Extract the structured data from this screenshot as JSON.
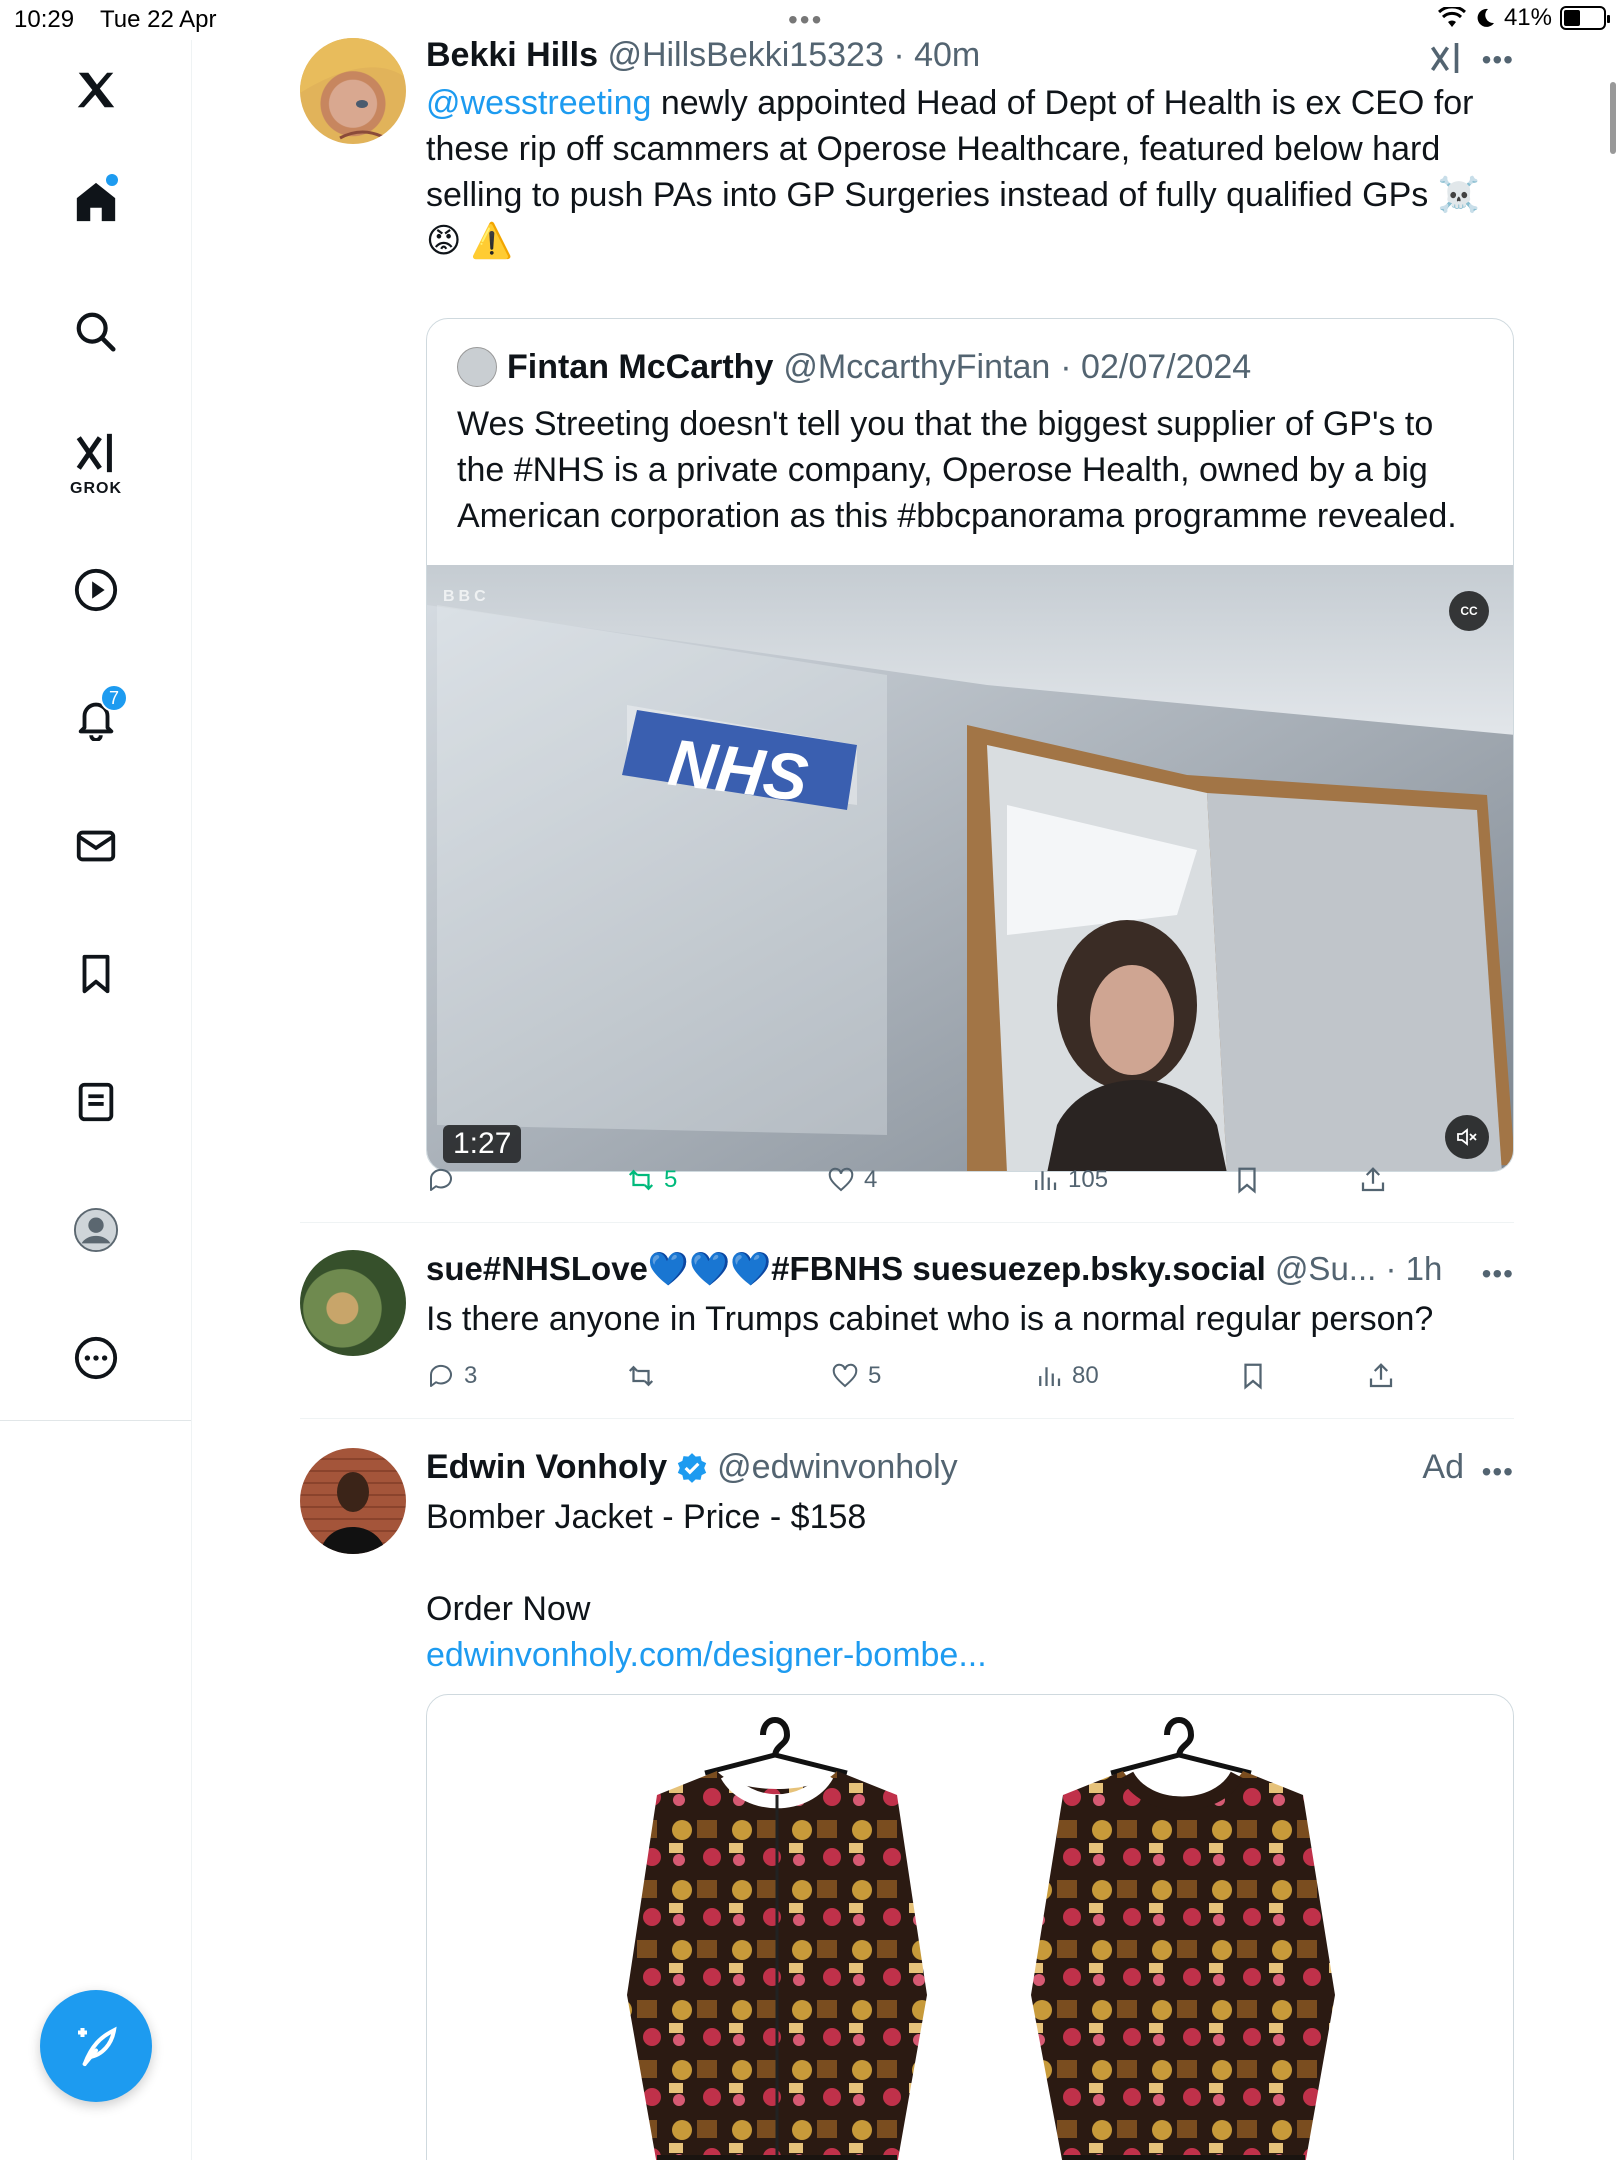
{
  "status_bar": {
    "time": "10:29",
    "date": "Tue 22 Apr",
    "battery": "41%"
  },
  "sidebar": {
    "notifications_count": "7",
    "grok_label": "GROK"
  },
  "tweets": [
    {
      "name": "Bekki Hills",
      "handle": "@HillsBekki15323",
      "time": "· 40m",
      "mention": "@wesstreeting",
      "text": " newly appointed  Head of Dept of Health is ex CEO for these rip off scammers at Operose Healthcare, featured below hard selling to push PAs into GP Surgeries instead of fully qualified GPs ☠️",
      "emoji_line": "😡 ⚠️",
      "quote": {
        "name": "Fintan McCarthy",
        "handle": "@MccarthyFintan",
        "date": "· 02/07/2024",
        "text": "Wes Streeting doesn't tell you that the biggest supplier of GP's to the #NHS is a private company, Operose Health, owned by a big American corporation as this #bbcpanorama programme revealed.",
        "video_duration": "1:27",
        "video_sign": "NHS",
        "video_watermark": "BBC",
        "cc_label": "CC"
      },
      "stats": {
        "replies": "",
        "retweets": "5",
        "likes": "4",
        "views": "105"
      }
    },
    {
      "name": "sue#NHSLove💙💙💙#FBNHS suesuezep.bsky.social",
      "handle": "@Su...",
      "time": "· 1h",
      "text": "Is there anyone in Trumps cabinet who is a normal regular person?",
      "stats": {
        "replies": "3",
        "retweets": "",
        "likes": "5",
        "views": "80"
      }
    },
    {
      "name": "Edwin Vonholy",
      "handle": "@edwinvonholy",
      "ad_label": "Ad",
      "line1": "Bomber Jacket - Price - $158",
      "line2": "Order Now",
      "link": "edwinvonholy.com/designer-bombe..."
    }
  ],
  "colors": {
    "accent": "#1d9bf0",
    "retweet_active": "#00ba7c",
    "muted": "#536471"
  }
}
